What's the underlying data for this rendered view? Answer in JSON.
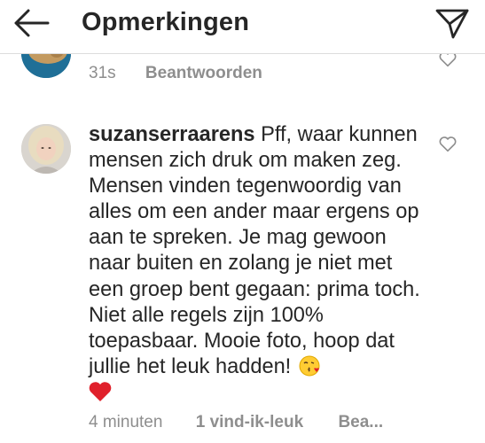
{
  "header": {
    "title": "Opmerkingen",
    "back_icon": "arrow-left-icon",
    "send_icon": "paper-plane-icon"
  },
  "previous_comment": {
    "time": "31s",
    "reply_label": "Beantwoorden"
  },
  "comment": {
    "username": "suzanserraarens",
    "text": "Pff, waar kunnen mensen zich druk om maken zeg. Mensen vinden tegenwoordig van alles om een ander maar ergens op aan te spreken. Je mag gewoon naar buiten en zolang je niet met een groep bent gegaan: prima toch. Niet alle regels zijn 100% toepasbaar. Mooie foto, hoop dat jullie het leuk hadden!",
    "emoji_1": "face-blowing-kiss-emoji",
    "emoji_2": "red-heart-emoji",
    "time": "4 minuten",
    "likes": "1 vind-ik-leuk",
    "reply_label": "Bea..."
  },
  "colors": {
    "text": "#262626",
    "secondary_text": "#8e8e8e",
    "heart_red": "#e0202b",
    "divider": "#dcdcdc"
  }
}
